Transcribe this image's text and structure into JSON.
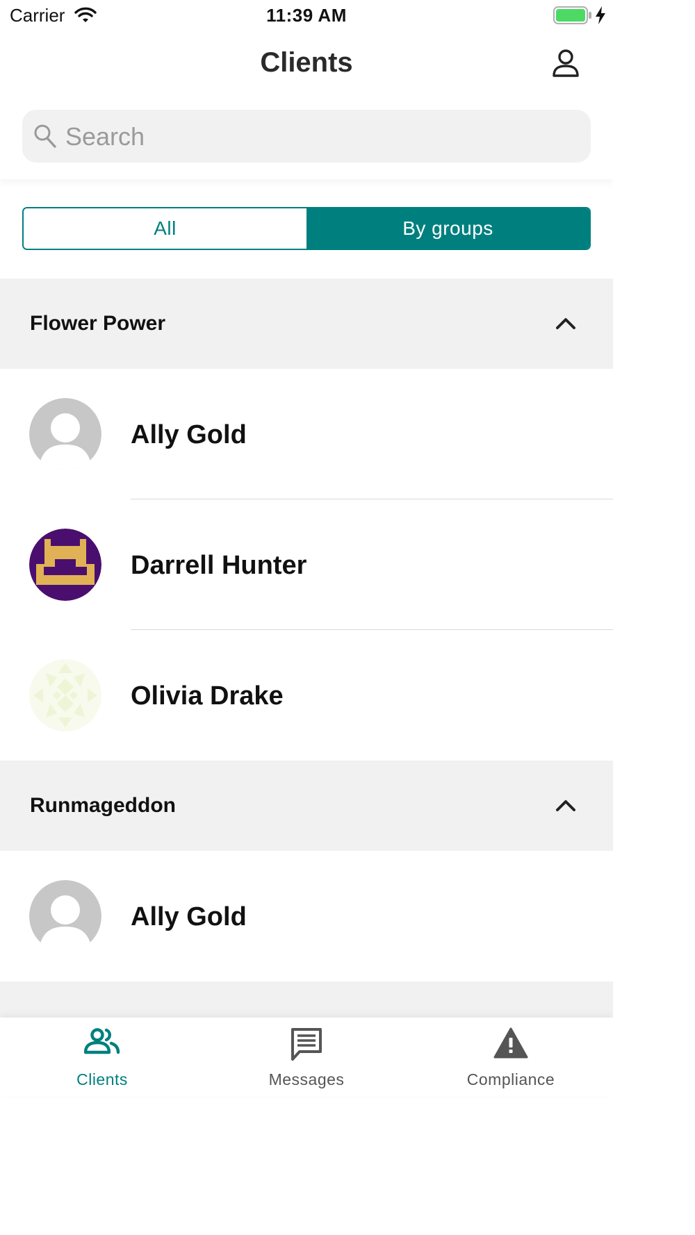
{
  "status_bar": {
    "carrier": "Carrier",
    "time": "11:39 AM"
  },
  "header": {
    "title": "Clients"
  },
  "search": {
    "placeholder": "Search",
    "value": ""
  },
  "segmented": {
    "all_label": "All",
    "by_groups_label": "By groups",
    "selected": "By groups"
  },
  "groups": [
    {
      "name": "Flower Power",
      "expanded": true,
      "clients": [
        "Ally Gold",
        "Darrell Hunter",
        "Olivia Drake"
      ]
    },
    {
      "name": "Runmageddon",
      "expanded": true,
      "clients": [
        "Ally Gold"
      ]
    }
  ],
  "tabs": [
    {
      "label": "Clients",
      "icon": "people-icon",
      "active": true
    },
    {
      "label": "Messages",
      "icon": "message-icon",
      "active": false
    },
    {
      "label": "Compliance",
      "icon": "warning-icon",
      "active": false
    }
  ],
  "colors": {
    "accent": "#007f7f",
    "section_bg": "#f1f1f1",
    "darrell_avatar_bg": "#4a0f6e",
    "darrell_avatar_fg": "#e1b155",
    "olivia_avatar_fg": "#eef5d6"
  }
}
